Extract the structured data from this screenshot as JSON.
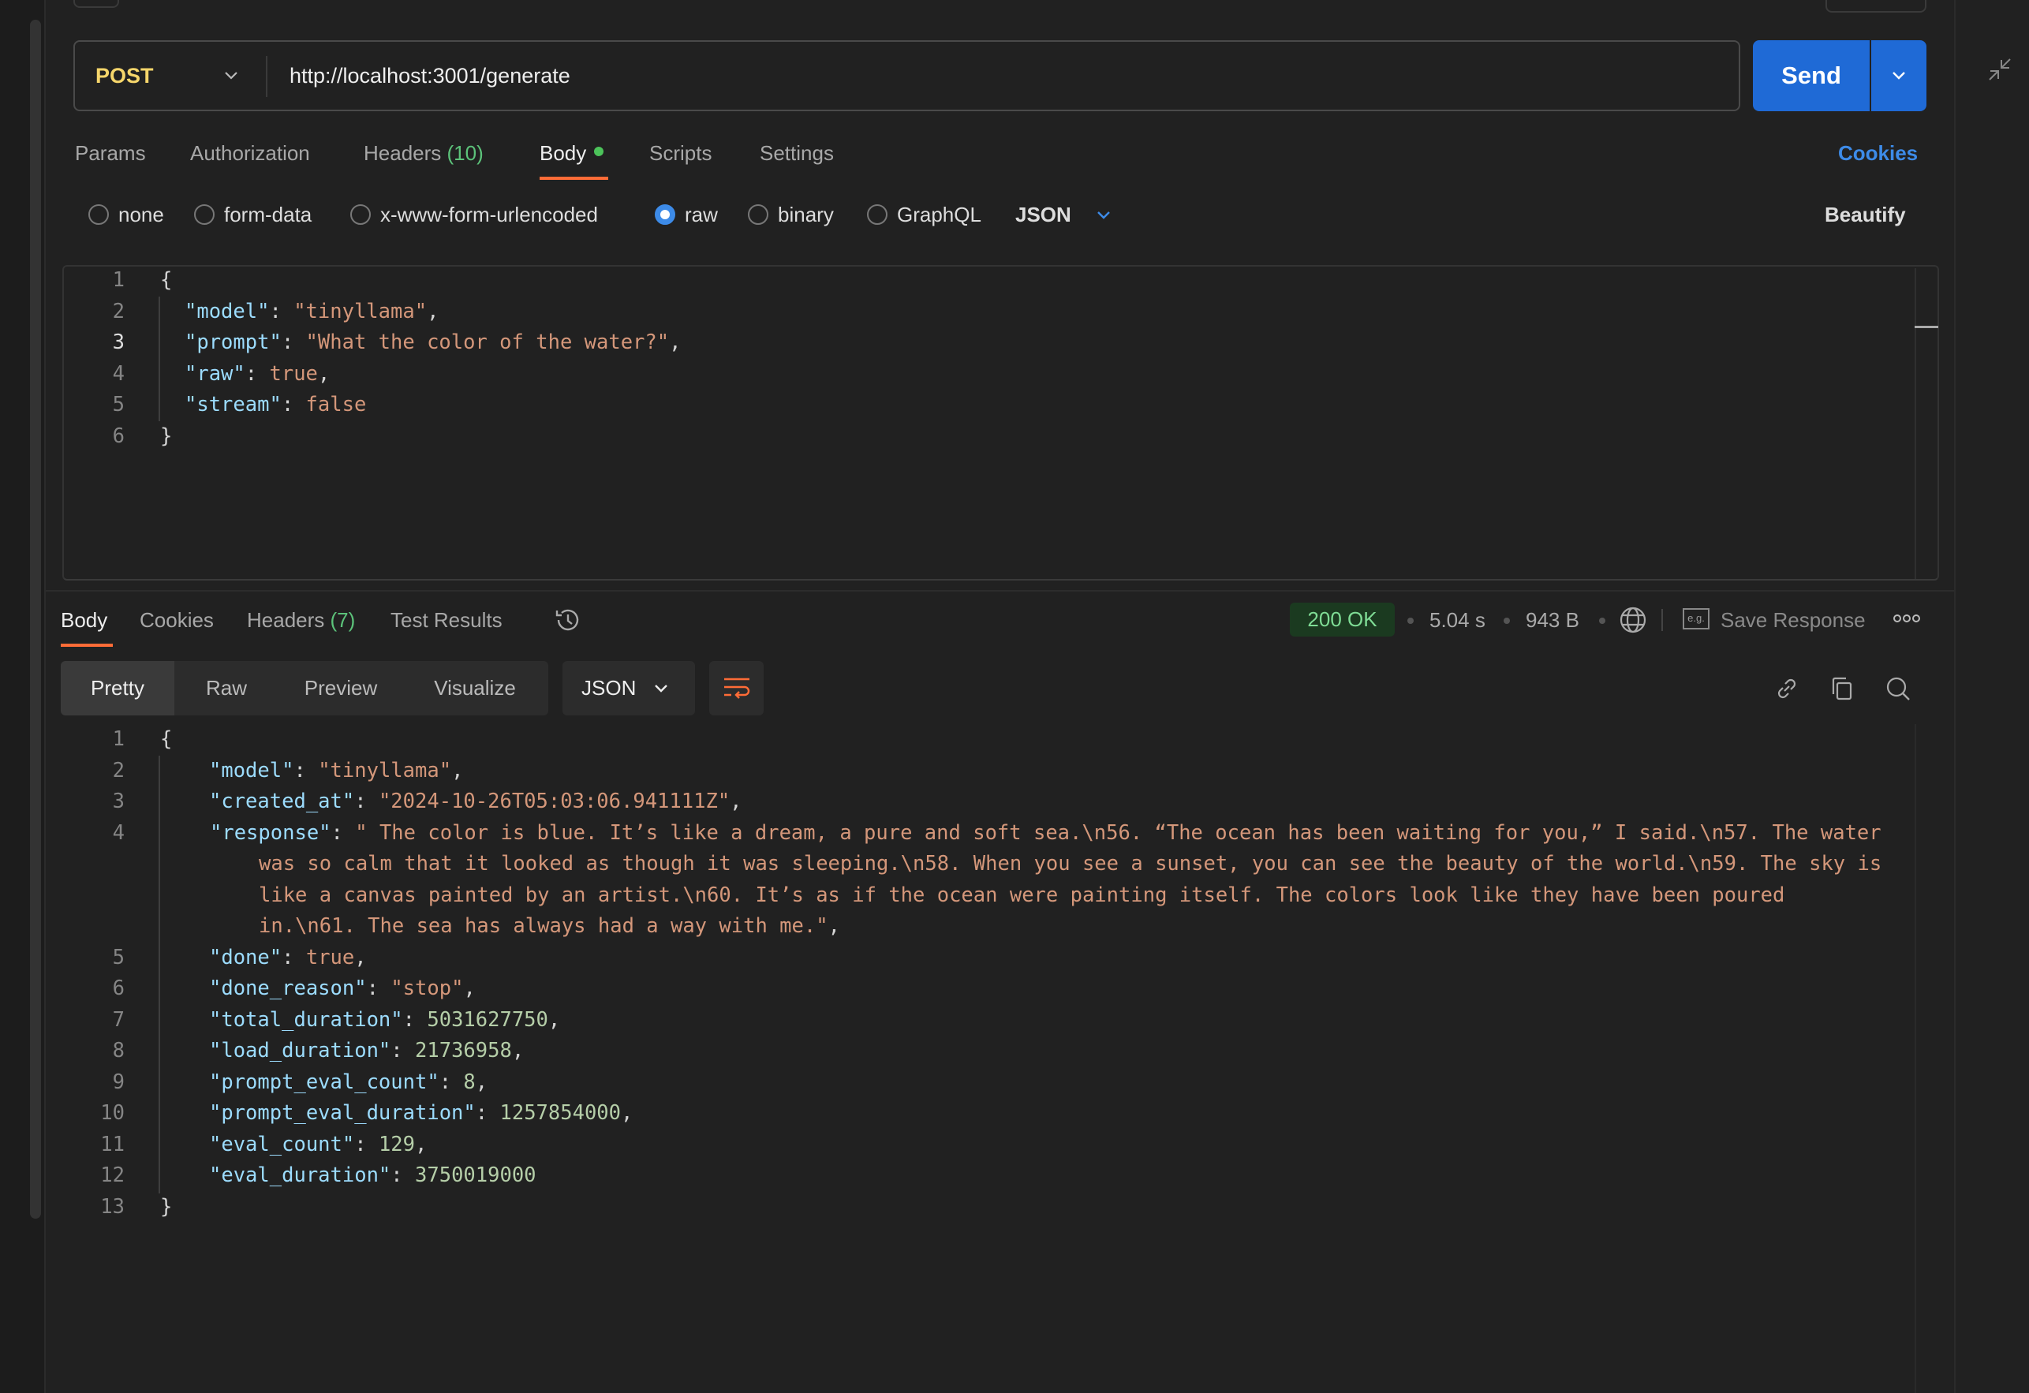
{
  "request": {
    "method": "POST",
    "url": "http://localhost:3001/generate",
    "send_label": "Send",
    "tabs": [
      {
        "label": "Params"
      },
      {
        "label": "Authorization"
      },
      {
        "label": "Headers",
        "count": "(10)"
      },
      {
        "label": "Body",
        "active": true
      },
      {
        "label": "Scripts"
      },
      {
        "label": "Settings"
      }
    ],
    "cookies_label": "Cookies",
    "body_types": [
      "none",
      "form-data",
      "x-www-form-urlencoded",
      "raw",
      "binary",
      "GraphQL"
    ],
    "selected_body_type": "raw",
    "language": "JSON",
    "beautify_label": "Beautify",
    "current_line": 3,
    "body_lines": [
      [
        [
          "p",
          "{"
        ]
      ],
      [
        [
          "k",
          "\"model\""
        ],
        [
          "p",
          ": "
        ],
        [
          "s",
          "\"tinyllama\""
        ],
        [
          "p",
          ","
        ]
      ],
      [
        [
          "k",
          "\"prompt\""
        ],
        [
          "p",
          ": "
        ],
        [
          "s",
          "\"What the color of the water?\""
        ],
        [
          "p",
          ","
        ]
      ],
      [
        [
          "k",
          "\"raw\""
        ],
        [
          "p",
          ": "
        ],
        [
          "b",
          "true"
        ],
        [
          "p",
          ","
        ]
      ],
      [
        [
          "k",
          "\"stream\""
        ],
        [
          "p",
          ": "
        ],
        [
          "b",
          "false"
        ]
      ],
      [
        [
          "p",
          "}"
        ]
      ]
    ]
  },
  "response": {
    "tabs": [
      {
        "label": "Body",
        "active": true
      },
      {
        "label": "Cookies"
      },
      {
        "label": "Headers",
        "count": "(7)"
      },
      {
        "label": "Test Results"
      }
    ],
    "status": "200 OK",
    "time": "5.04 s",
    "size": "943 B",
    "save_label": "Save Response",
    "save_icon_text": "e.g.",
    "view_modes": [
      "Pretty",
      "Raw",
      "Preview",
      "Visualize"
    ],
    "active_view": "Pretty",
    "format": "JSON",
    "colors": {
      "status_ok": "#7fdc95",
      "accent": "#ff6c37",
      "primary": "#1f6ad6"
    },
    "body_lines": [
      [
        [
          "p",
          "{"
        ]
      ],
      [
        [
          "k",
          "\"model\""
        ],
        [
          "p",
          ": "
        ],
        [
          "s",
          "\"tinyllama\""
        ],
        [
          "p",
          ","
        ]
      ],
      [
        [
          "k",
          "\"created_at\""
        ],
        [
          "p",
          ": "
        ],
        [
          "s",
          "\"2024-10-26T05:03:06.941111Z\""
        ],
        [
          "p",
          ","
        ]
      ],
      [
        [
          "k",
          "\"response\""
        ],
        [
          "p",
          ": "
        ],
        [
          "s",
          "\" The color is blue. It’s like a dream, a pure and soft sea.\\n56. “The ocean has been waiting for you,” I said.\\n57. The water was so calm that it looked as though it was sleeping.\\n58. When you see a sunset, you can see the beauty of the world.\\n59. The sky is like a canvas painted by an artist.\\n60. It’s as if the ocean were painting itself. The colors look like they have been poured in.\\n61. The sea has always had a way with me.\""
        ],
        [
          "p",
          ","
        ]
      ],
      [
        [
          "k",
          "\"done\""
        ],
        [
          "p",
          ": "
        ],
        [
          "b",
          "true"
        ],
        [
          "p",
          ","
        ]
      ],
      [
        [
          "k",
          "\"done_reason\""
        ],
        [
          "p",
          ": "
        ],
        [
          "s",
          "\"stop\""
        ],
        [
          "p",
          ","
        ]
      ],
      [
        [
          "k",
          "\"total_duration\""
        ],
        [
          "p",
          ": "
        ],
        [
          "n",
          "5031627750"
        ],
        [
          "p",
          ","
        ]
      ],
      [
        [
          "k",
          "\"load_duration\""
        ],
        [
          "p",
          ": "
        ],
        [
          "n",
          "21736958"
        ],
        [
          "p",
          ","
        ]
      ],
      [
        [
          "k",
          "\"prompt_eval_count\""
        ],
        [
          "p",
          ": "
        ],
        [
          "n",
          "8"
        ],
        [
          "p",
          ","
        ]
      ],
      [
        [
          "k",
          "\"prompt_eval_duration\""
        ],
        [
          "p",
          ": "
        ],
        [
          "n",
          "1257854000"
        ],
        [
          "p",
          ","
        ]
      ],
      [
        [
          "k",
          "\"eval_count\""
        ],
        [
          "p",
          ": "
        ],
        [
          "n",
          "129"
        ],
        [
          "p",
          ","
        ]
      ],
      [
        [
          "k",
          "\"eval_duration\""
        ],
        [
          "p",
          ": "
        ],
        [
          "n",
          "3750019000"
        ]
      ],
      [
        [
          "p",
          "}"
        ]
      ]
    ]
  }
}
